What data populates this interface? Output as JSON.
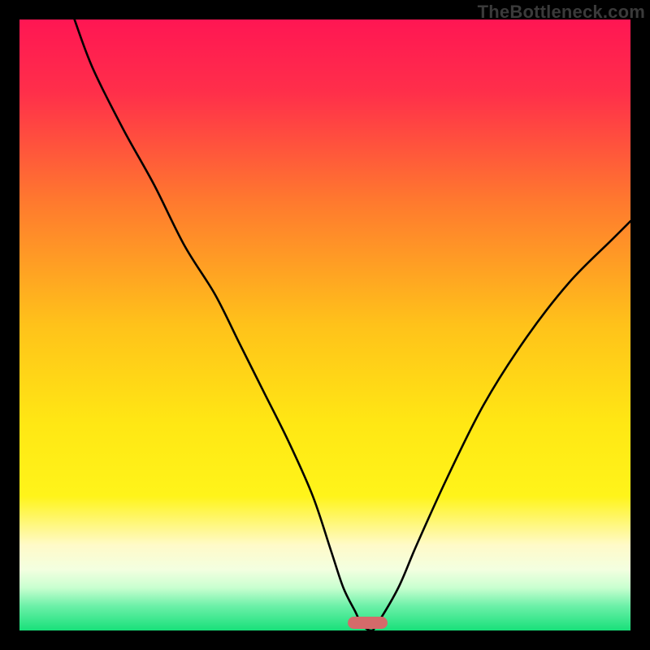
{
  "watermark": "TheBottleneck.com",
  "colors": {
    "frame": "#000000",
    "curve": "#000000",
    "marker": "#d46a6a",
    "watermark": "#3a3a3a",
    "gradient_stops": [
      {
        "pos": 0.0,
        "color": "#ff1653"
      },
      {
        "pos": 0.12,
        "color": "#ff2f4a"
      },
      {
        "pos": 0.3,
        "color": "#ff7a2e"
      },
      {
        "pos": 0.5,
        "color": "#ffc21a"
      },
      {
        "pos": 0.66,
        "color": "#ffe714"
      },
      {
        "pos": 0.78,
        "color": "#fff41a"
      },
      {
        "pos": 0.86,
        "color": "#fffac8"
      },
      {
        "pos": 0.9,
        "color": "#f3ffe0"
      },
      {
        "pos": 0.93,
        "color": "#c9ffd0"
      },
      {
        "pos": 0.96,
        "color": "#6cf0a8"
      },
      {
        "pos": 1.0,
        "color": "#18e07a"
      }
    ]
  },
  "chart_data": {
    "type": "line",
    "title": "",
    "xlabel": "",
    "ylabel": "",
    "xlim": [
      0,
      100
    ],
    "ylim": [
      0,
      100
    ],
    "grid": false,
    "legend": false,
    "series": [
      {
        "name": "bottleneck-curve",
        "x": [
          9,
          12,
          17,
          22,
          27,
          32,
          36,
          40,
          44,
          48,
          51,
          53,
          55,
          56,
          57.5,
          58.5,
          62,
          65,
          70,
          76,
          83,
          90,
          97,
          100
        ],
        "y": [
          100,
          92,
          82,
          73,
          63,
          55,
          47,
          39,
          31,
          22,
          13,
          7,
          3,
          1,
          0,
          1,
          7,
          14,
          25,
          37,
          48,
          57,
          64,
          67
        ]
      }
    ],
    "annotations": [
      {
        "type": "marker",
        "name": "minimum-pill",
        "x_center": 57,
        "x_halfwidth": 3.3,
        "y": 1.3
      }
    ]
  }
}
